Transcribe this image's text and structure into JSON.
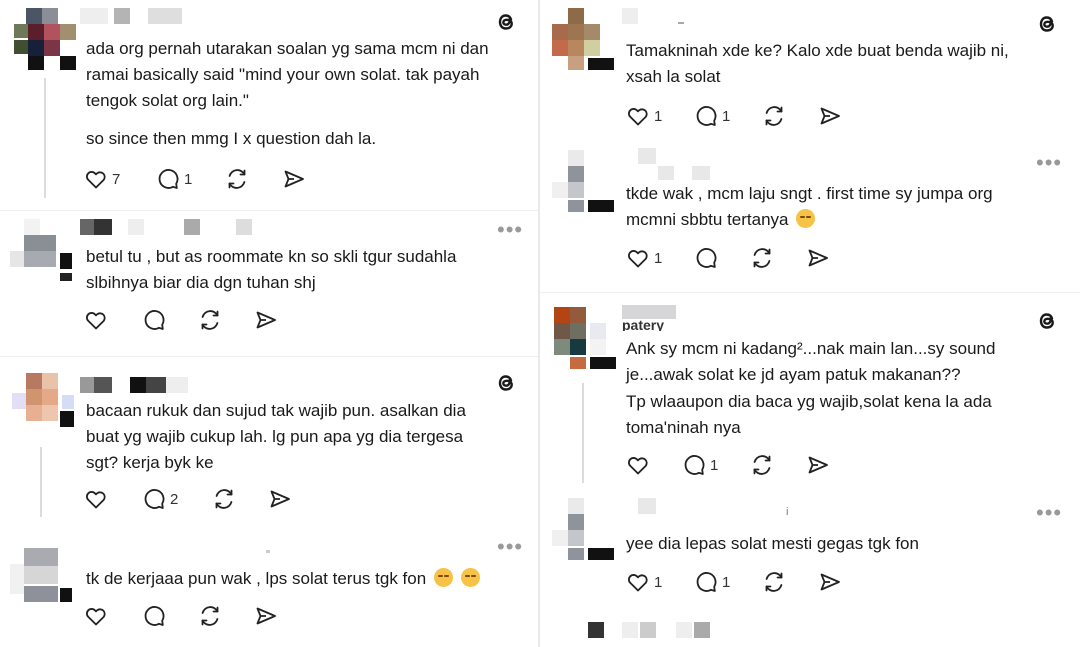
{
  "colors": {
    "text": "#1a1a1a",
    "muted": "#999999",
    "icon": "#222222",
    "background": "#ffffff"
  },
  "icons": [
    "threads-logo-icon",
    "heart-icon",
    "comment-icon",
    "repost-icon",
    "share-icon",
    "more-icon",
    "emoji-icon"
  ],
  "posts": [
    {
      "lines": [
        "ada org pernah utarakan soalan yg sama mcm ni dan",
        "ramai basically said \"mind your own solat. tak payah",
        "tengok solat org lain.\""
      ],
      "paragraph2": "so since then mmg I x question dah la.",
      "likes": "7",
      "replies": "1",
      "show_logo": true
    },
    {
      "lines": [
        "betul tu , but as roommate kn so skli tgur sudahla",
        "slbihnya biar dia dgn tuhan shj"
      ],
      "likes": "",
      "replies": "",
      "show_more": true
    },
    {
      "lines": [
        "bacaan rukuk dan sujud tak wajib pun. asalkan dia",
        "buat yg wajib cukup lah. lg pun apa yg dia tergesa",
        "sgt? kerja byk ke"
      ],
      "likes": "",
      "replies": "2",
      "show_logo": true
    },
    {
      "line1": "tk de kerjaaa pun wak , lps solat terus tgk fon",
      "likes": "",
      "replies": "",
      "show_more": true
    },
    {
      "lines": [
        "Tamakninah xde ke? Kalo xde buat benda wajib ni,",
        "xsah la solat"
      ],
      "likes": "1",
      "replies": "1",
      "show_logo": true
    },
    {
      "line1": "tkde wak , mcm laju sngt . first time sy jumpa org",
      "line2": "mcmni sbbtu tertanya",
      "likes": "1",
      "replies": "",
      "show_more": true
    },
    {
      "username_fragment": "patery",
      "lines": [
        "Ank sy mcm ni kadang²...nak main lan...sy sound",
        "je...awak solat ke jd ayam patuk makanan??"
      ],
      "paragraph2_lines": [
        "Tp wlaaupon dia baca yg wajib,solat kena la ada",
        "toma'ninah nya"
      ],
      "likes": "",
      "replies": "1",
      "show_logo": true
    },
    {
      "username_fragment": "i",
      "line1": "yee dia lepas solat mesti gegas tgk fon",
      "likes": "1",
      "replies": "1",
      "show_more": true
    }
  ]
}
